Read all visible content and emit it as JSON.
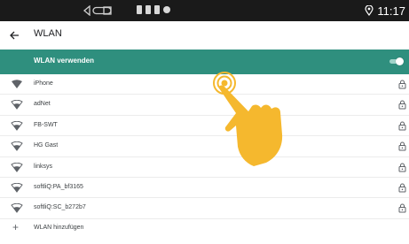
{
  "status_bar": {
    "time": "11:17",
    "icons": [
      "nav-back-triangle-icon",
      "nav-home-pill-icon",
      "nav-recents-square-icon",
      "notification-icons",
      "location-icon"
    ]
  },
  "app_bar": {
    "back_icon": "arrow-back-icon",
    "title": "WLAN"
  },
  "master_toggle": {
    "label": "WLAN verwenden",
    "state": "on",
    "accent_color": "#2f8f7e"
  },
  "networks": [
    {
      "ssid": "iPhone",
      "signal": "full",
      "secured": true
    },
    {
      "ssid": "adNet",
      "signal": "medium",
      "secured": true
    },
    {
      "ssid": "FB-SWT",
      "signal": "medium",
      "secured": true
    },
    {
      "ssid": "HG Gast",
      "signal": "medium",
      "secured": true
    },
    {
      "ssid": "linksys",
      "signal": "medium",
      "secured": true
    },
    {
      "ssid": "softliQ:PA_bf3165",
      "signal": "medium",
      "secured": true
    },
    {
      "ssid": "softliQ:SC_b272b7",
      "signal": "medium",
      "secured": true
    }
  ],
  "add_network": {
    "label": "WLAN hinzufügen",
    "icon": "plus-icon"
  },
  "overlay": {
    "icon": "tap-gesture-hand-icon",
    "color": "#f5b82e"
  }
}
